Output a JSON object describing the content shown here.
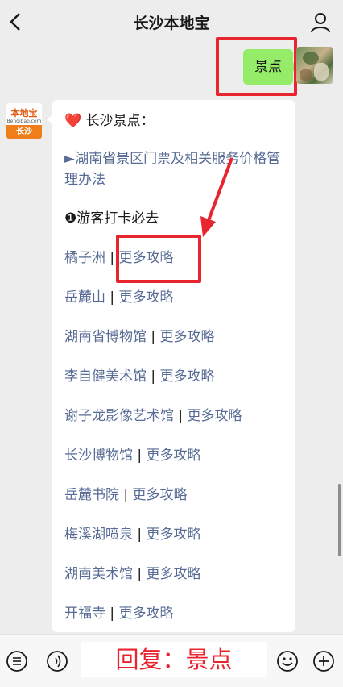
{
  "header": {
    "title": "长沙本地宝"
  },
  "my_message": {
    "text": "景点"
  },
  "bot": {
    "avatar_top": "本地宝",
    "avatar_url": "Bendibao.com",
    "avatar_bottom": "长沙",
    "heading": "长沙景点：",
    "regulation": "►湖南省景区门票及相关服务价格管理办法",
    "section": "❶游客打卡必去",
    "sep": "|",
    "items": [
      {
        "name": "橘子洲",
        "more": "更多攻略"
      },
      {
        "name": "岳麓山",
        "more": "更多攻略"
      },
      {
        "name": "湖南省博物馆",
        "more": "更多攻略"
      },
      {
        "name": "李自健美术馆",
        "more": "更多攻略"
      },
      {
        "name": "谢子龙影像艺术馆",
        "more": "更多攻略"
      },
      {
        "name": "长沙博物馆",
        "more": "更多攻略"
      },
      {
        "name": "岳麓书院",
        "more": "更多攻略"
      },
      {
        "name": "梅溪湖喷泉",
        "more": "更多攻略"
      },
      {
        "name": "湖南美术馆",
        "more": "更多攻略"
      },
      {
        "name": "开福寺",
        "more": "更多攻略"
      }
    ]
  },
  "input": {
    "text": "回复：景点"
  },
  "colors": {
    "accent_red": "#e8242f",
    "link_blue": "#576b95",
    "bubble_green": "#95ec69"
  }
}
